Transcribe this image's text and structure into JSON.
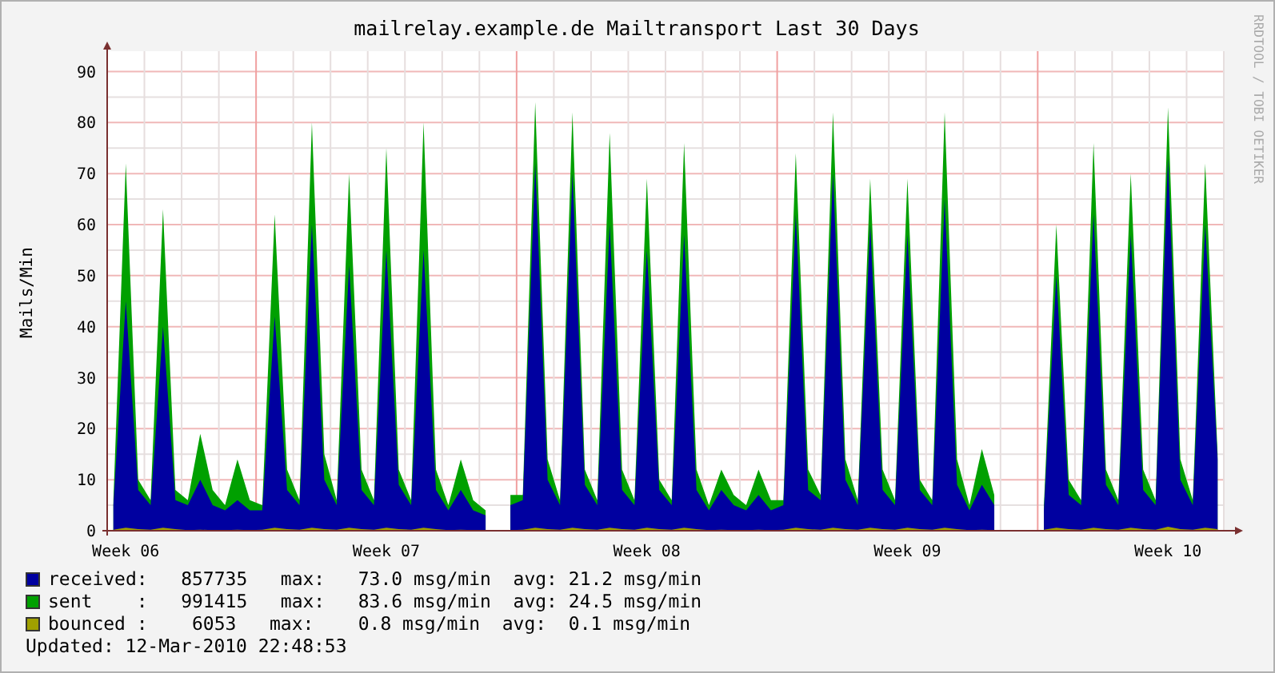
{
  "title": "mailrelay.example.de Mailtransport Last 30 Days",
  "credit": "RRDTOOL / TOBI OETIKER",
  "chart_data": {
    "type": "area",
    "ylabel": "Mails/Min",
    "grid": true,
    "ylim": [
      0,
      94
    ],
    "categories": [
      null,
      "Week 06",
      null,
      null,
      null,
      null,
      null,
      null,
      null,
      null,
      null,
      null,
      null,
      null,
      null,
      null,
      null,
      null,
      null,
      null,
      null,
      null,
      "Week 07",
      null,
      null,
      null,
      null,
      null,
      null,
      null,
      null,
      null,
      null,
      null,
      null,
      null,
      null,
      null,
      null,
      null,
      null,
      null,
      null,
      "Week 08",
      null,
      null,
      null,
      null,
      null,
      null,
      null,
      null,
      null,
      null,
      null,
      null,
      null,
      null,
      null,
      null,
      null,
      null,
      null,
      null,
      "Week 09",
      null,
      null,
      null,
      null,
      null,
      null,
      null,
      null,
      null,
      null,
      null,
      null,
      null,
      null,
      null,
      null,
      null,
      null,
      null,
      null,
      "Week 10",
      null,
      null,
      null,
      null
    ],
    "yticks": [
      0,
      10,
      20,
      30,
      40,
      50,
      60,
      70,
      80,
      90
    ],
    "series": [
      {
        "name": "received",
        "color": "#0000a0",
        "values": [
          5,
          45,
          8,
          5,
          40,
          6,
          5,
          10,
          5,
          4,
          6,
          4,
          4,
          42,
          8,
          5,
          60,
          10,
          5,
          52,
          8,
          5,
          55,
          9,
          5,
          55,
          8,
          4,
          8,
          4,
          3,
          null,
          5,
          6,
          72,
          10,
          5,
          70,
          9,
          5,
          60,
          8,
          5,
          55,
          8,
          5,
          58,
          8,
          4,
          8,
          5,
          4,
          7,
          4,
          5,
          62,
          8,
          6,
          70,
          10,
          5,
          60,
          8,
          5,
          58,
          8,
          5,
          65,
          9,
          4,
          9,
          5,
          null,
          null,
          null,
          4,
          50,
          7,
          5,
          62,
          9,
          5,
          58,
          8,
          5,
          73,
          10,
          5,
          60,
          14
        ]
      },
      {
        "name": "sent",
        "color": "#00a000",
        "values": [
          6,
          72,
          10,
          6,
          63,
          8,
          6,
          19,
          8,
          5,
          14,
          6,
          5,
          62,
          12,
          6,
          80,
          15,
          6,
          70,
          12,
          6,
          75,
          12,
          6,
          80,
          12,
          5,
          14,
          6,
          4,
          null,
          7,
          7,
          84,
          14,
          6,
          82,
          12,
          6,
          78,
          12,
          6,
          69,
          10,
          6,
          76,
          12,
          5,
          12,
          7,
          5,
          12,
          6,
          6,
          74,
          12,
          7,
          82,
          14,
          6,
          69,
          12,
          6,
          69,
          10,
          6,
          82,
          14,
          5,
          16,
          7,
          null,
          null,
          null,
          5,
          60,
          10,
          6,
          76,
          12,
          6,
          70,
          12,
          6,
          83,
          14,
          6,
          72,
          15
        ]
      },
      {
        "name": "bounced",
        "color": "#a0a000",
        "values": [
          0.2,
          0.6,
          0.3,
          0.2,
          0.6,
          0.3,
          0.1,
          0.2,
          0.1,
          0.1,
          0.2,
          0.1,
          0.2,
          0.6,
          0.3,
          0.2,
          0.6,
          0.3,
          0.2,
          0.6,
          0.3,
          0.2,
          0.6,
          0.3,
          0.2,
          0.6,
          0.3,
          0.1,
          0.2,
          0.1,
          0.1,
          null,
          0.1,
          0.2,
          0.6,
          0.3,
          0.2,
          0.6,
          0.3,
          0.2,
          0.6,
          0.3,
          0.2,
          0.6,
          0.3,
          0.2,
          0.6,
          0.3,
          0.1,
          0.2,
          0.1,
          0.1,
          0.2,
          0.1,
          0.2,
          0.6,
          0.3,
          0.2,
          0.6,
          0.3,
          0.2,
          0.6,
          0.3,
          0.2,
          0.6,
          0.3,
          0.2,
          0.6,
          0.3,
          0.1,
          0.2,
          0.1,
          null,
          null,
          null,
          0.2,
          0.6,
          0.3,
          0.2,
          0.6,
          0.3,
          0.2,
          0.6,
          0.3,
          0.2,
          0.8,
          0.3,
          0.2,
          0.6,
          0.3
        ]
      }
    ]
  },
  "legend": [
    {
      "text": ":   857735   max:   73.0 msg/min  avg: 21.2 msg/min"
    },
    {
      "text": "    :   991415   max:   83.6 msg/min  avg: 24.5 msg/min"
    },
    {
      "text": " :    6053   max:    0.8 msg/min  avg:  0.1 msg/min"
    }
  ],
  "updated": "Updated: 12-Mar-2010 22:48:53"
}
